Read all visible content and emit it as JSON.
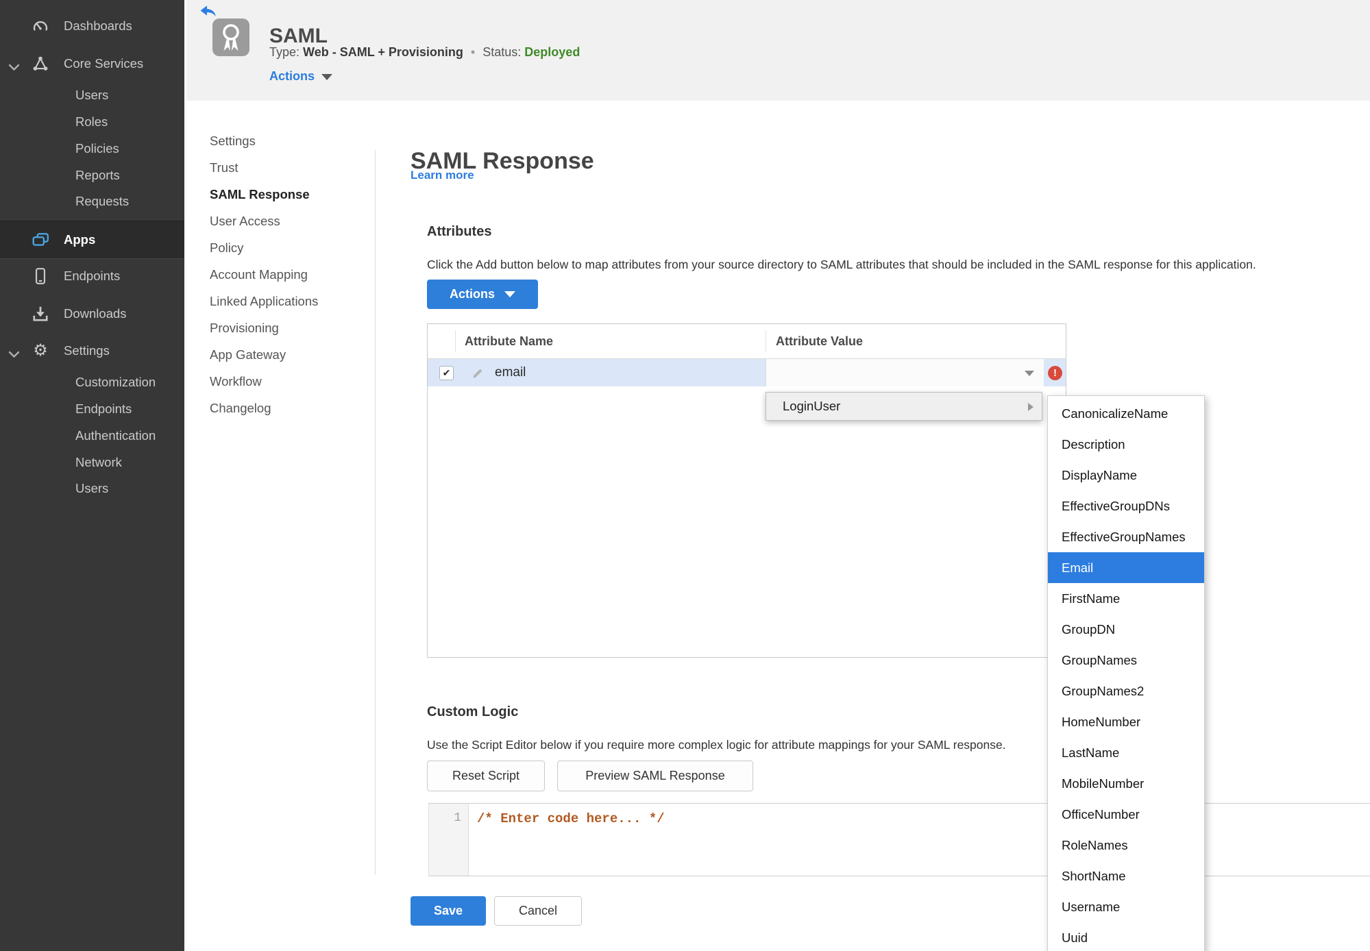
{
  "icons": {
    "check": "✔",
    "error": "!",
    "gear": "⚙"
  },
  "sidebar": {
    "items": [
      {
        "label": "Dashboards"
      },
      {
        "label": "Core Services"
      },
      {
        "label": "Users"
      },
      {
        "label": "Roles"
      },
      {
        "label": "Policies"
      },
      {
        "label": "Reports"
      },
      {
        "label": "Requests"
      },
      {
        "label": "Apps"
      },
      {
        "label": "Endpoints"
      },
      {
        "label": "Downloads"
      },
      {
        "label": "Settings"
      },
      {
        "label": "Customization"
      },
      {
        "label": "Endpoints"
      },
      {
        "label": "Authentication"
      },
      {
        "label": "Network"
      },
      {
        "label": "Users"
      }
    ]
  },
  "header": {
    "title": "SAML",
    "type_label": "Type:",
    "type_value": "Web - SAML + Provisioning",
    "separator": "•",
    "status_label": "Status:",
    "status_value": "Deployed",
    "actions_label": "Actions"
  },
  "subnav": {
    "items": [
      "Settings",
      "Trust",
      "SAML Response",
      "User Access",
      "Policy",
      "Account Mapping",
      "Linked Applications",
      "Provisioning",
      "App Gateway",
      "Workflow",
      "Changelog"
    ]
  },
  "main": {
    "title": "SAML Response",
    "learn_more": "Learn more",
    "attributes": {
      "heading": "Attributes",
      "description": "Click the Add button below to map attributes from your source directory to SAML attributes that should be included in the SAML response for this application.",
      "actions_button": "Actions",
      "table": {
        "col_name": "Attribute Name",
        "col_value": "Attribute Value",
        "row_name": "email"
      }
    },
    "value_menu": {
      "label": "LoginUser"
    },
    "value_submenu": {
      "selected": "Email",
      "items": [
        "CanonicalizeName",
        "Description",
        "DisplayName",
        "EffectiveGroupDNs",
        "EffectiveGroupNames",
        "Email",
        "FirstName",
        "GroupDN",
        "GroupNames",
        "GroupNames2",
        "HomeNumber",
        "LastName",
        "MobileNumber",
        "OfficeNumber",
        "RoleNames",
        "ShortName",
        "Username",
        "Uuid"
      ]
    },
    "custom_logic": {
      "heading": "Custom Logic",
      "description": "Use the Script Editor below if you require more complex logic for attribute mappings for your SAML response.",
      "reset_button": "Reset Script",
      "preview_button": "Preview SAML Response"
    },
    "editor": {
      "line_number": "1",
      "code": "/* Enter code here... */"
    },
    "footer": {
      "save": "Save",
      "cancel": "Cancel"
    }
  },
  "colors": {
    "accent": "#2e7fd9",
    "status_green": "#3f8a28",
    "error_red": "#d9493c",
    "selection_blue": "#2d7de0",
    "row_highlight": "#dbe7f8"
  }
}
